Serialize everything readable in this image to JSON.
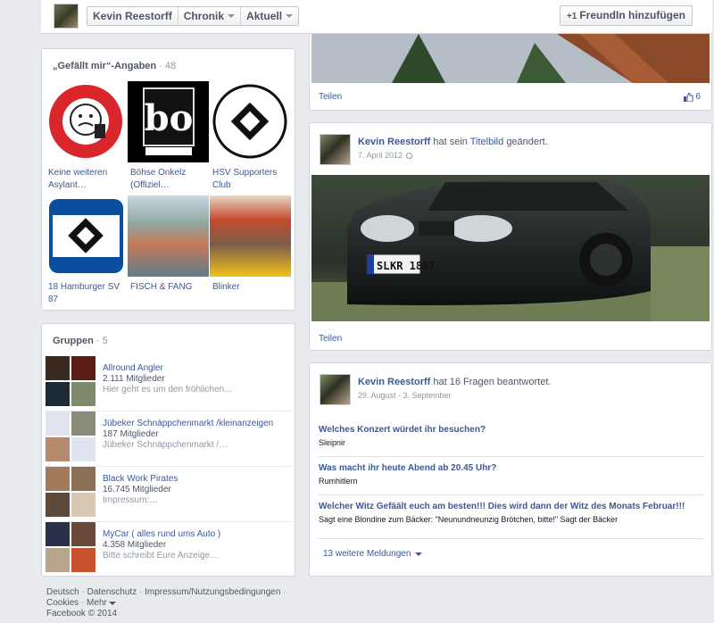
{
  "topbar": {
    "name": "Kevin Reestorff",
    "chronik": "Chronik",
    "aktuell": "Aktuell",
    "add_friend": "FreundIn hinzufügen",
    "add_friend_plus": "+1"
  },
  "likes": {
    "title": "„Gefällt mir“-Angaben",
    "count": "· 48",
    "items": [
      {
        "label": "Keine weiteren Asylant…",
        "icon": "thumbs-down-logo"
      },
      {
        "label": "Böhse Onkelz (Offiziel…",
        "icon": "bo-logo"
      },
      {
        "label": "HSV Supporters Club",
        "icon": "hsv-diamond-logo"
      },
      {
        "label": "18 Hamburger SV 87",
        "icon": "hsv-diamond-logo"
      },
      {
        "label": "FISCH & FANG",
        "icon": "magazine-cover"
      },
      {
        "label": "Blinker",
        "icon": "magazine-cover"
      }
    ]
  },
  "groups": {
    "title": "Gruppen",
    "count": "· 5",
    "items": [
      {
        "name": "Allround Angler",
        "members": "2.111 Mitglieder",
        "desc": "Hier geht es um den fröhlichen…"
      },
      {
        "name": "Jübeker Schnäppchenmarkt /kleinanzeigen",
        "members": "187 Mitglieder",
        "desc": "Jübeker Schnäppchenmarkt /…"
      },
      {
        "name": "Black Work Pirates",
        "members": "16.745 Mitglieder",
        "desc": "Impressum:…"
      },
      {
        "name": "MyCar ( alles rund ums Auto )",
        "members": "4.358 Mitglieder",
        "desc": "Bitte schreibt Eure Anzeige…"
      }
    ]
  },
  "footer": {
    "line1": [
      "Deutsch",
      "Datenschutz",
      "Impressum/Nutzungsbedingungen"
    ],
    "cookies": "Cookies",
    "mehr": "Mehr",
    "copyright": "Facebook © 2014",
    "sep": "·"
  },
  "top_post": {
    "share": "Teilen",
    "likes": "6"
  },
  "post1": {
    "name": "Kevin Reestorff",
    "action_pre": "hat sein",
    "action_link": "Titelbild",
    "action_post": "geändert.",
    "date": "7. April 2012",
    "share": "Teilen",
    "plate_left": "SL",
    "plate_right": "KR 1887"
  },
  "post2": {
    "name": "Kevin Reestorff",
    "action": "hat 16 Fragen beantwortet.",
    "date": "29. August - 3. September",
    "qa": [
      {
        "q": "Welches Konzert würdet ihr besuchen?",
        "a": "Sleipnir"
      },
      {
        "q": "Was macht ihr heute Abend ab 20.45 Uhr?",
        "a": "Rumhitlern"
      },
      {
        "q": "Welcher Witz Gefäält euch am besten!!! Dies wird dann der Witz des Monats Februar!!!",
        "a": "Sagt eine Blondine zum Bäcker: \"Neunundneunzig Brötchen, bitte!\" Sagt der Bäcker"
      }
    ],
    "more": "13 weitere Meldungen"
  }
}
